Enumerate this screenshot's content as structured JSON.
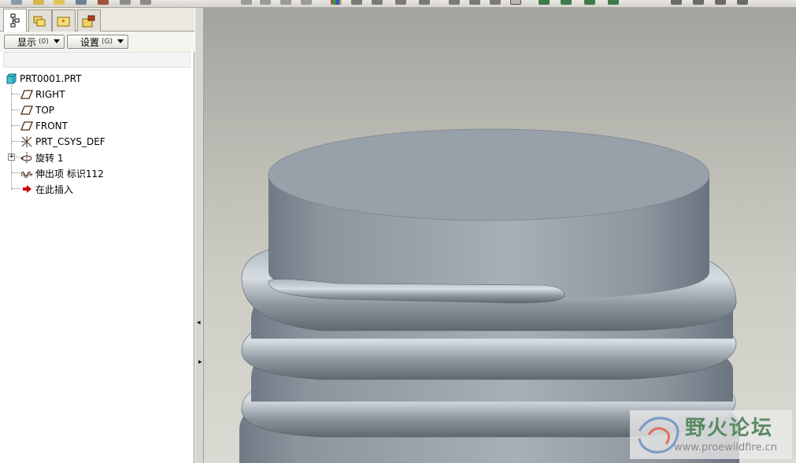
{
  "panel": {
    "buttons": {
      "display_label": "显示",
      "display_accel": "(0)",
      "settings_label": "设置",
      "settings_accel": "(G)"
    }
  },
  "model_tree": {
    "root": "PRT0001.PRT",
    "items": [
      {
        "label": "RIGHT",
        "icon": "datum-plane-icon"
      },
      {
        "label": "TOP",
        "icon": "datum-plane-icon"
      },
      {
        "label": "FRONT",
        "icon": "datum-plane-icon"
      },
      {
        "label": "PRT_CSYS_DEF",
        "icon": "coordinate-system-icon"
      },
      {
        "label": "旋转 1",
        "icon": "revolve-icon",
        "expandable": true
      },
      {
        "label": "伸出项 标识112",
        "icon": "protrusion-icon"
      },
      {
        "label": "在此插入",
        "icon": "insert-here-arrow-icon"
      }
    ]
  },
  "viewport": {
    "model": "threaded-cylinder-part"
  },
  "watermark": {
    "title": "野火论坛",
    "url": "www.proewildfire.cn"
  },
  "colors": {
    "accent_insert_arrow": "#cc0000",
    "model_surface": "#9aa3ab"
  }
}
